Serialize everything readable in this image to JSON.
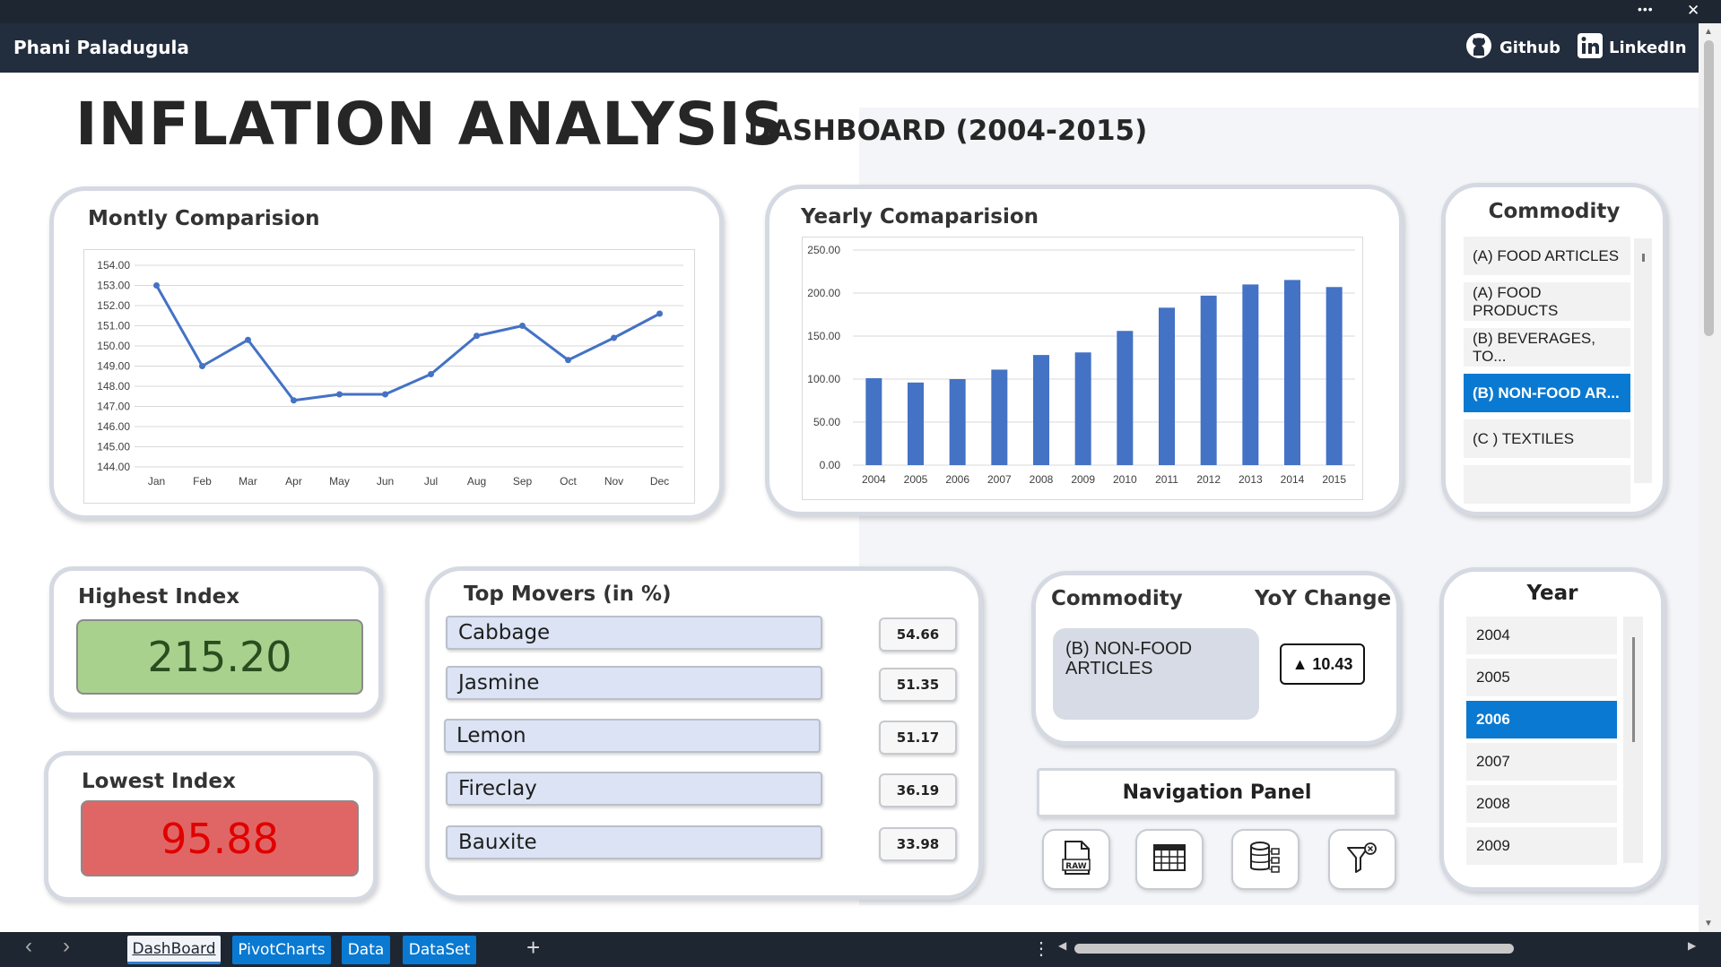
{
  "window": {
    "author": "Phani Paladugula",
    "links": [
      {
        "label": "Github",
        "icon": "github-icon"
      },
      {
        "label": "LinkedIn",
        "icon": "linkedin-icon"
      }
    ],
    "menu_glyph": "•••",
    "close_glyph": "✕"
  },
  "dashboard": {
    "title": "INFLATION ANALYSIS",
    "subtitle": "DASHBOARD (2004-2015)"
  },
  "monthly": {
    "title": "Montly Comparision"
  },
  "yearly": {
    "title": "Yearly Comaparision"
  },
  "commodity_slicer": {
    "title": "Commodity",
    "items": [
      "(A) FOOD ARTICLES",
      "(A) FOOD PRODUCTS",
      "(B) BEVERAGES, TO...",
      "(B) NON-FOOD AR...",
      "(C ) TEXTILES"
    ],
    "selected": "(B) NON-FOOD AR..."
  },
  "highest": {
    "title": "Highest Index",
    "value": "215.20",
    "color": "#a9d18e"
  },
  "lowest": {
    "title": "Lowest Index",
    "value": "95.88",
    "color": "#e06666"
  },
  "movers": {
    "title": "Top Movers (in %)",
    "items": [
      {
        "name": "Cabbage",
        "value": "54.66"
      },
      {
        "name": "Jasmine",
        "value": "51.35"
      },
      {
        "name": "Lemon",
        "value": "51.17"
      },
      {
        "name": "Fireclay",
        "value": "36.19"
      },
      {
        "name": "Bauxite",
        "value": "33.98"
      }
    ]
  },
  "yoy": {
    "commodity_label": "Commodity",
    "change_label": "YoY Change",
    "commodity_value": "(B) NON-FOOD ARTICLES",
    "change_value": "▲ 10.43"
  },
  "nav": {
    "title": "Navigation Panel",
    "buttons": [
      {
        "icon": "raw-file-icon"
      },
      {
        "icon": "table-grid-icon"
      },
      {
        "icon": "database-icon"
      },
      {
        "icon": "clear-filter-icon"
      }
    ]
  },
  "year_slicer": {
    "title": "Year",
    "items": [
      "2004",
      "2005",
      "2006",
      "2007",
      "2008",
      "2009"
    ],
    "selected": "2006"
  },
  "sheet_tabs": {
    "tabs": [
      "DashBoard",
      "PivotCharts",
      "Data",
      "DataSet"
    ],
    "active": "DashBoard",
    "add": "+",
    "prev": "‹",
    "next": "›",
    "more": "⋮"
  },
  "colors": {
    "accent": "#4472c4",
    "selected": "#0a79d1",
    "header": "#222d3d"
  },
  "chart_data": [
    {
      "type": "line",
      "title": "Montly Comparision",
      "categories": [
        "Jan",
        "Feb",
        "Mar",
        "Apr",
        "May",
        "Jun",
        "Jul",
        "Aug",
        "Sep",
        "Oct",
        "Nov",
        "Dec"
      ],
      "values": [
        153.0,
        149.0,
        150.3,
        147.3,
        147.6,
        147.6,
        148.6,
        150.5,
        151.0,
        149.3,
        150.4,
        151.6
      ],
      "ylim": [
        144,
        154
      ],
      "yticks": [
        "154.00",
        "153.00",
        "152.00",
        "151.00",
        "150.00",
        "149.00",
        "148.00",
        "147.00",
        "146.00",
        "145.00",
        "144.00"
      ],
      "grid": true,
      "legend": "none"
    },
    {
      "type": "bar",
      "title": "Yearly Comaparision",
      "categories": [
        "2004",
        "2005",
        "2006",
        "2007",
        "2008",
        "2009",
        "2010",
        "2011",
        "2012",
        "2013",
        "2014",
        "2015"
      ],
      "values": [
        101,
        96,
        100,
        111,
        128,
        131,
        156,
        183,
        197,
        210,
        215.2,
        207
      ],
      "ylim": [
        0,
        250
      ],
      "yticks": [
        "250.00",
        "200.00",
        "150.00",
        "100.00",
        "50.00",
        "0.00"
      ],
      "grid": true,
      "legend": "none"
    }
  ]
}
